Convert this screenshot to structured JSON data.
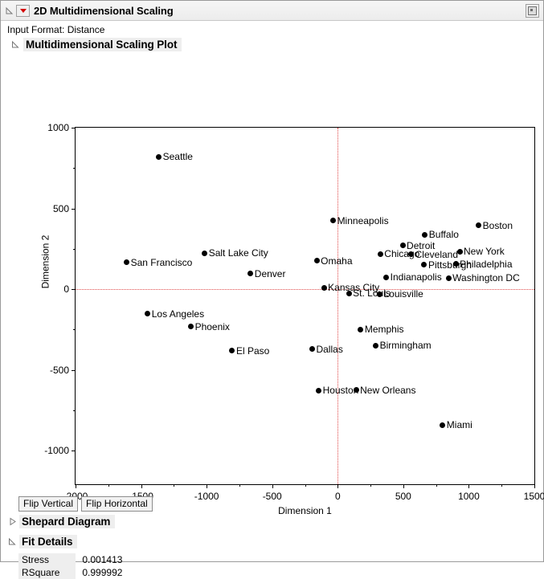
{
  "window": {
    "title": "2D Multidimensional Scaling",
    "red_triangle_icon": "red-triangle-menu-icon",
    "close_icon": "close-window-icon"
  },
  "report": {
    "input_format_label": "Input Format: Distance",
    "plot_section_title": "Multidimensional Scaling Plot",
    "shepard_section_title": "Shepard Diagram",
    "fit_section_title": "Fit Details"
  },
  "toolbar": {
    "flip_vertical_label": "Flip Vertical",
    "flip_horizontal_label": "Flip Horizontal"
  },
  "fit_details": {
    "rows": [
      {
        "label": "Stress",
        "value": "0.001413"
      },
      {
        "label": "RSquare",
        "value": "0.999992"
      }
    ]
  },
  "chart_data": {
    "type": "scatter",
    "title": "Multidimensional Scaling Plot",
    "xlabel": "Dimension 1",
    "ylabel": "Dimension 2",
    "xlim": [
      -2000,
      1500
    ],
    "ylim": [
      -1208,
      1000
    ],
    "xticks": [
      -2000,
      -1500,
      -1000,
      -500,
      0,
      500,
      1000,
      1500
    ],
    "yticks": [
      1000,
      500,
      0,
      -500,
      -1000
    ],
    "grid": false,
    "legend": "none",
    "reference_lines": {
      "x": 0,
      "y": 0,
      "color": "#e04a4a",
      "style": "dotted"
    },
    "marker": {
      "shape": "circle",
      "color": "#000000",
      "size": 7
    },
    "points": [
      {
        "label": "Seattle",
        "x": -1365,
        "y": 820,
        "label_side": "right"
      },
      {
        "label": "San Francisco",
        "x": -1610,
        "y": 167,
        "label_side": "right"
      },
      {
        "label": "Salt Lake City",
        "x": -1015,
        "y": 222,
        "label_side": "right"
      },
      {
        "label": "Denver",
        "x": -665,
        "y": 95,
        "label_side": "right"
      },
      {
        "label": "Los Angeles",
        "x": -1450,
        "y": -152,
        "label_side": "right"
      },
      {
        "label": "Phoenix",
        "x": -1120,
        "y": -232,
        "label_side": "right"
      },
      {
        "label": "El Paso",
        "x": -805,
        "y": -382,
        "label_side": "right"
      },
      {
        "label": "Dallas",
        "x": -195,
        "y": -372,
        "label_side": "right"
      },
      {
        "label": "Houston",
        "x": -145,
        "y": -628,
        "label_side": "right"
      },
      {
        "label": "Omaha",
        "x": -160,
        "y": 175,
        "label_side": "right"
      },
      {
        "label": "Kansas City",
        "x": -105,
        "y": 10,
        "label_side": "right"
      },
      {
        "label": "Minneapolis",
        "x": -35,
        "y": 425,
        "label_side": "right"
      },
      {
        "label": "St. Louis",
        "x": 85,
        "y": -25,
        "label_side": "right"
      },
      {
        "label": "Louisville",
        "x": 320,
        "y": -30,
        "label_side": "right"
      },
      {
        "label": "Memphis",
        "x": 175,
        "y": -250,
        "label_side": "right"
      },
      {
        "label": "New Orleans",
        "x": 140,
        "y": -625,
        "label_side": "right"
      },
      {
        "label": "Birmingham",
        "x": 290,
        "y": -350,
        "label_side": "right"
      },
      {
        "label": "Miami",
        "x": 800,
        "y": -840,
        "label_side": "right"
      },
      {
        "label": "Chicago",
        "x": 325,
        "y": 218,
        "label_side": "right"
      },
      {
        "label": "Indianapolis",
        "x": 370,
        "y": 75,
        "label_side": "right"
      },
      {
        "label": "Detroit",
        "x": 495,
        "y": 270,
        "label_side": "right"
      },
      {
        "label": "Cleveland",
        "x": 560,
        "y": 215,
        "label_side": "right"
      },
      {
        "label": "Buffalo",
        "x": 665,
        "y": 338,
        "label_side": "right"
      },
      {
        "label": "Pittsburgh",
        "x": 660,
        "y": 150,
        "label_side": "right"
      },
      {
        "label": "New York",
        "x": 930,
        "y": 232,
        "label_side": "right"
      },
      {
        "label": "Philadelphia",
        "x": 900,
        "y": 155,
        "label_side": "right"
      },
      {
        "label": "Washington DC",
        "x": 845,
        "y": 70,
        "label_side": "right"
      },
      {
        "label": "Boston",
        "x": 1075,
        "y": 395,
        "label_side": "right"
      }
    ]
  }
}
